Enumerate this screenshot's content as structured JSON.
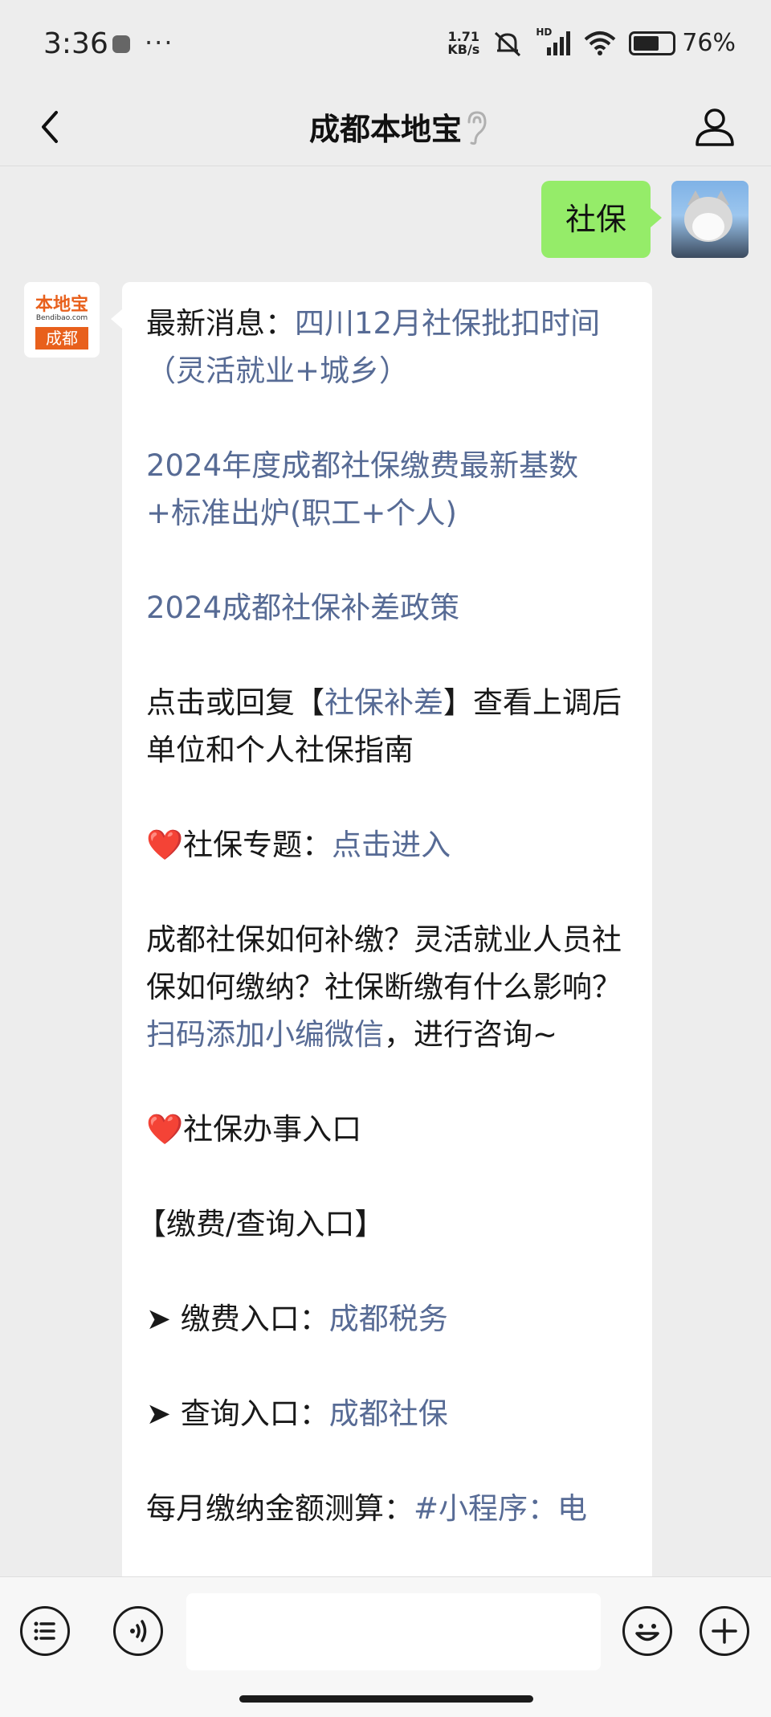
{
  "status_bar": {
    "time": "3:36",
    "more": "···",
    "net_speed_top": "1.71",
    "net_speed_bottom": "KB/s",
    "network": "HD",
    "battery": "76%",
    "battery_level": 0.76
  },
  "nav": {
    "title": "成都本地宝"
  },
  "outgoing": {
    "text": "社保"
  },
  "bot_avatar": {
    "logo_top": "本地宝",
    "logo_mid": "Bendibao.com",
    "logo_bottom": "成都"
  },
  "message": {
    "latest_label": "最新消息：",
    "latest_link": "四川12月社保批扣时间（灵活就业+城乡）",
    "link_2024_base": "2024年度成都社保缴费最新基数+标准出炉(职工+个人)",
    "link_2024_policy": "2024成都社保补差政策",
    "reply_pre": "点击或回复【",
    "reply_link": "社保补差",
    "reply_post": "】查看上调后单位和个人社保指南",
    "topic_heart": "❤️",
    "topic_label": "社保专题：",
    "topic_link": "点击进入",
    "consult_text": "成都社保如何补缴？灵活就业人员社保如何缴纳？社保断缴有什么影响？",
    "consult_link": "扫码添加小编微信",
    "consult_tail": "，进行咨询~",
    "entry_heart": "❤️",
    "entry_title": "社保办事入口",
    "section_title": "【缴费/查询入口】",
    "pay_arrow": "➤",
    "pay_label": "缴费入口：",
    "pay_link": "成都税务",
    "query_arrow": "➤",
    "query_label": "查询入口：",
    "query_link": "成都社保",
    "calc_label": "每月缴纳金额测算：",
    "calc_link": "#小程序：电"
  },
  "colors": {
    "background": "#ededed",
    "outgoing_bubble": "#95ec69",
    "link": "#576b95",
    "brand_orange": "#e8601c"
  },
  "icons": [
    "back-icon",
    "ear-icon",
    "profile-icon",
    "menu-list-icon",
    "voice-icon",
    "emoji-icon",
    "plus-icon"
  ]
}
